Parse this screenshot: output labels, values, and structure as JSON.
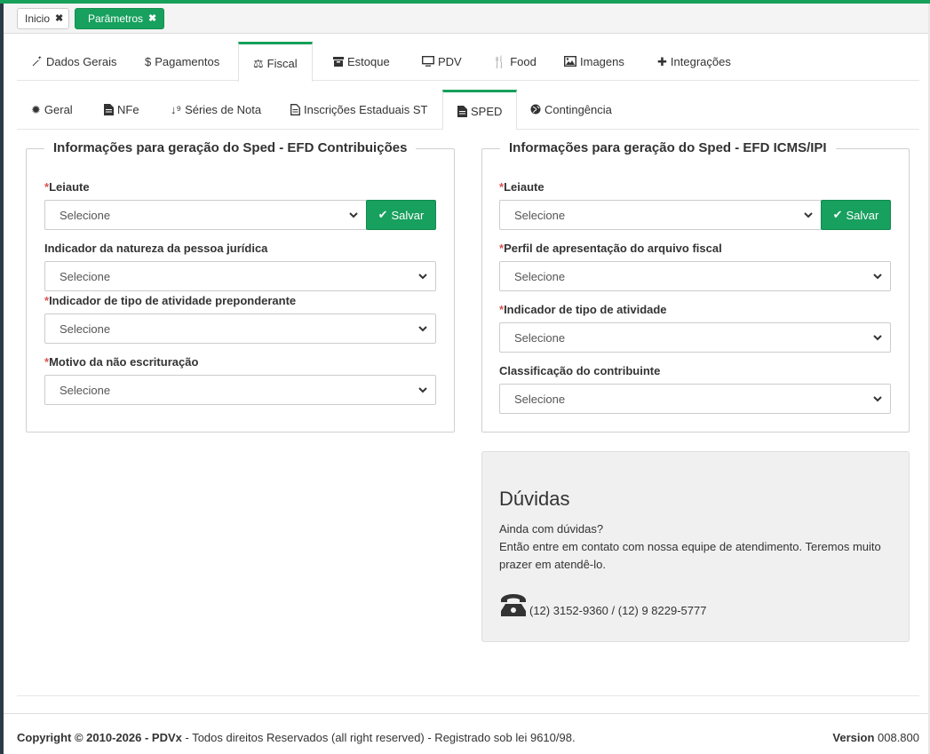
{
  "top_tabs": [
    {
      "label": "Inicio"
    },
    {
      "label": "Parâmetros"
    }
  ],
  "main_nav": [
    {
      "label": "Dados Gerais",
      "icon": "wrench-icon"
    },
    {
      "label": "Pagamentos",
      "icon": "dollar-icon"
    },
    {
      "label": "Fiscal",
      "icon": "balance-scale-icon"
    },
    {
      "label": "Estoque",
      "icon": "archive-box-icon"
    },
    {
      "label": "PDV",
      "icon": "monitor-icon"
    },
    {
      "label": "Food",
      "icon": "cutlery-icon"
    },
    {
      "label": "Imagens",
      "icon": "image-icon"
    },
    {
      "label": "Integrações",
      "icon": "puzzle-icon"
    }
  ],
  "sub_nav": [
    {
      "label": "Geral",
      "icon": "gear-icon"
    },
    {
      "label": "NFe",
      "icon": "file-icon"
    },
    {
      "label": "Séries de Nota",
      "icon": "sort-numeric-icon"
    },
    {
      "label": "Inscrições Estaduais ST",
      "icon": "document-icon"
    },
    {
      "label": "SPED",
      "icon": "file-text-icon"
    },
    {
      "label": "Contingência",
      "icon": "globe-icon"
    }
  ],
  "left_panel": {
    "title": "Informações para geração do Sped - EFD Contribuições",
    "fields": [
      {
        "label": "Leiaute",
        "value": "Selecione"
      },
      {
        "label": "Indicador da natureza da pessoa jurídica",
        "value": "Selecione"
      },
      {
        "label": "Indicador de tipo de atividade preponderante",
        "value": "Selecione"
      },
      {
        "label": "Motivo da não escrituração",
        "value": "Selecione"
      }
    ],
    "save_label": "Salvar"
  },
  "right_panel": {
    "title": "Informações para geração do Sped - EFD ICMS/IPI",
    "fields": [
      {
        "label": "Leiaute",
        "value": "Selecione"
      },
      {
        "label": "Perfil de apresentação do arquivo fiscal",
        "value": "Selecione"
      },
      {
        "label": "Indicador de tipo de atividade",
        "value": "Selecione"
      },
      {
        "label": "Classificação do contribuinte",
        "value": "Selecione"
      }
    ],
    "save_label": "Salvar"
  },
  "help": {
    "title": "Dúvidas",
    "line1": "Ainda com dúvidas?",
    "line2": "Então entre em contato com nossa equipe de atendimento. Teremos muito prazer em atendê-lo.",
    "phones": "(12) 3152-9360 / (12) 9 8229-5777"
  },
  "footer": {
    "copyright_bold": "Copyright © 2010-2026 - PDVx",
    "copyright_rest": " - Todos direitos Reservados (all right reserved) - Registrado sob lei 9610/98.",
    "version_label": "Version",
    "version_value": " 008.800"
  },
  "colors": {
    "accent": "#17a05e",
    "required": "#d9534f"
  }
}
